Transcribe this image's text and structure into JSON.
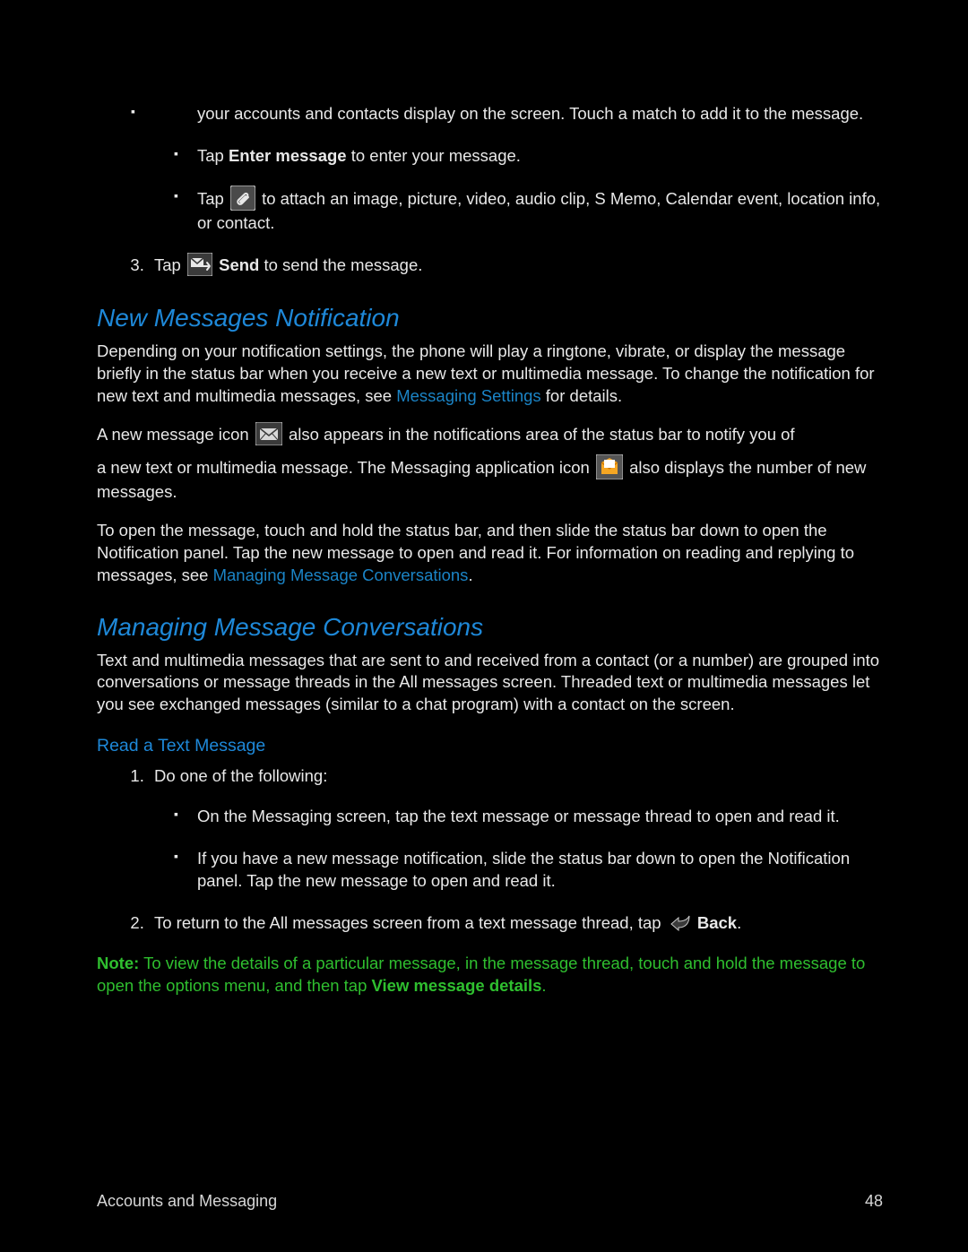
{
  "top_fragment": {
    "continued_text": "your accounts and contacts display on the screen. Touch a match to add it to the message.",
    "bullet1_prefix": "Tap ",
    "bullet1_bold": "Enter message",
    "bullet1_suffix": " to enter your message.",
    "bullet2_prefix": "Tap ",
    "bullet2_suffix": " to attach an image, picture, video, audio clip, S Memo, Calendar event, location info, or contact.",
    "item3_prefix": "Tap ",
    "item3_bold": " Send",
    "item3_suffix": " to send the message."
  },
  "section1": {
    "heading": "New Messages Notification",
    "para1_a": "Depending on your notification settings, the phone will play a ringtone, vibrate, or display the message briefly in the status bar when you receive a new text or multimedia message. To change the notification for new text and multimedia messages, see ",
    "para1_link": "Messaging Settings",
    "para1_b": " for details.",
    "para2_a": "A new message icon ",
    "para2_b": " also appears in the notifications area of the status bar to notify you of",
    "para2_c": "a new text or multimedia message. The Messaging application icon ",
    "para2_d": " also displays the number of new messages.",
    "para3_a": "To open the message, touch and hold the status bar, and then slide the status bar down to open the Notification panel. Tap the new message to open and read it. For information on reading and replying to messages, see ",
    "para3_link": "Managing Message Conversations",
    "para3_b": "."
  },
  "section2": {
    "heading": "Managing Message Conversations",
    "para1": "Text and multimedia messages that are sent to and received from a contact (or a number) are grouped into conversations or message threads in the All messages screen. Threaded text or multimedia messages let you see exchanged messages (similar to a chat program) with a contact on the screen.",
    "sub_heading": "Read a Text Message",
    "item1": "Do one of the following:",
    "sub_bullet1": "On the Messaging screen, tap the text message or message thread to open and read it.",
    "sub_bullet2": "If you have a new message notification, slide the status bar down to open the Notification panel. Tap the new message to open and read it.",
    "item2_a": "To return to the All messages screen from a text message thread, tap ",
    "item2_bold": " Back",
    "item2_b": ".",
    "note_bold1": "Note:",
    "note_a": " To view the details of a particular message, in the message thread, touch and hold the message to open the options menu, and then tap ",
    "note_bold2": "View message details",
    "note_b": "."
  },
  "footer": {
    "section": "Accounts and Messaging",
    "page": "48"
  }
}
